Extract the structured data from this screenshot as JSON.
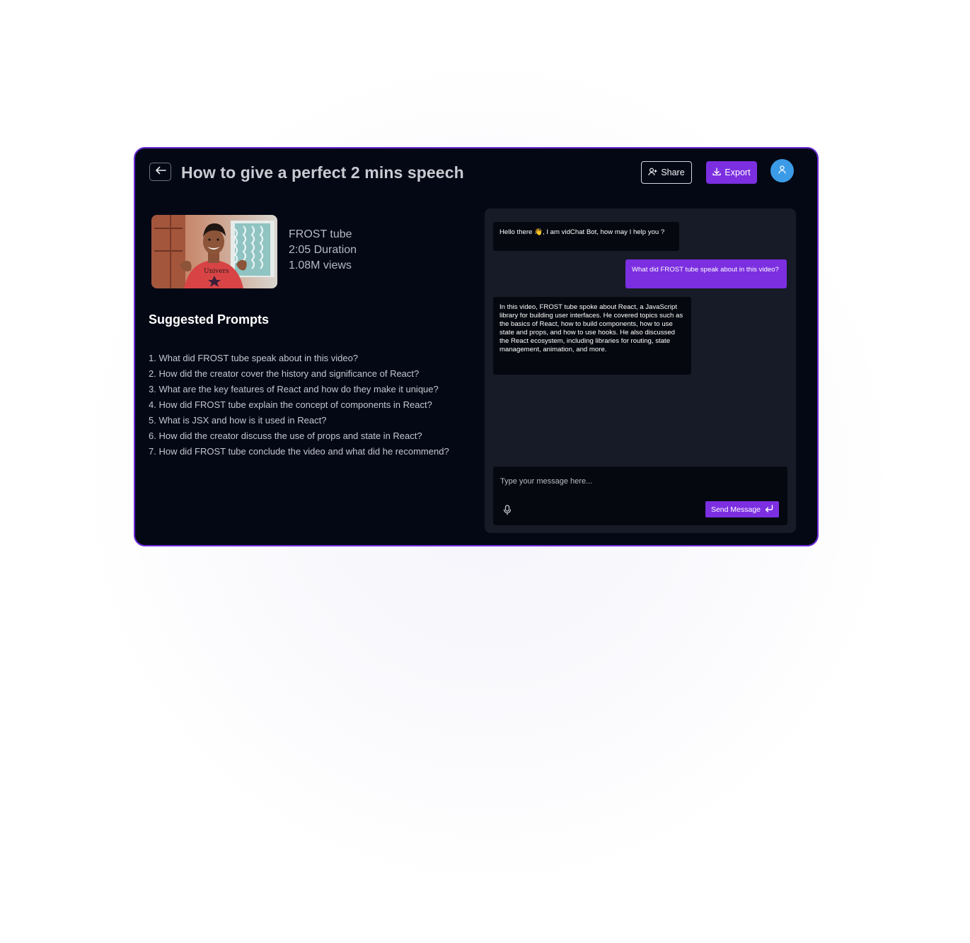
{
  "header": {
    "back_icon": "arrow-left-icon",
    "title": "How to give a perfect 2 mins speech",
    "share_label": "Share",
    "share_icon": "user-plus-icon",
    "export_label": "Export",
    "export_icon": "download-icon",
    "avatar_icon": "user-icon"
  },
  "video": {
    "channel": "FROST tube",
    "duration": "2:05 Duration",
    "views": "1.08M views",
    "thumbnail_shirt_text": "Univers"
  },
  "prompts": {
    "heading": "Suggested Prompts",
    "items": [
      "1. What did FROST tube speak about in this video?",
      "2. How did the creator cover the history and significance of React?",
      "3. What are the key features of React and how do they make it unique?",
      "4. How did FROST tube explain the concept of components in React?",
      "5. What is JSX and how is it used in React?",
      "6. How did the creator discuss the use of props and state in React?",
      "7. How did FROST tube conclude the video and what did he recommend?"
    ]
  },
  "chat": {
    "messages": [
      {
        "role": "bot",
        "text": "Hello there 👋, I am vidChat Bot, how may I help you ?"
      },
      {
        "role": "user",
        "text": "What did FROST tube speak about in this video?"
      },
      {
        "role": "bot",
        "text": "In this video, FROST tube spoke about React, a JavaScript library for building user interfaces. He covered topics such as the basics of React, how to build components, how to use state and props, and how to use hooks. He also discussed the React ecosystem, including libraries for routing, state  management, animation, and more."
      }
    ],
    "input_placeholder": "Type your message here...",
    "mic_icon": "microphone-icon",
    "send_label": "Send Message",
    "send_icon": "enter-arrow-icon"
  },
  "colors": {
    "accent": "#7c2fe0",
    "background": "#040815",
    "panel": "#171b27",
    "avatar": "#3b9be6"
  }
}
